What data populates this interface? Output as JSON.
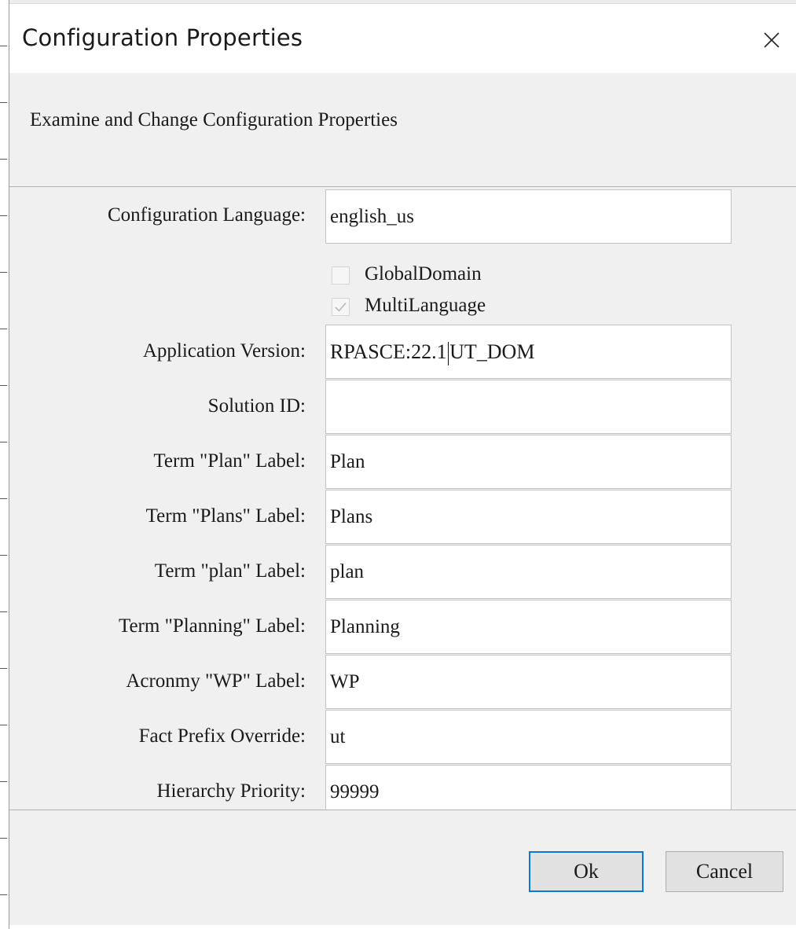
{
  "dialog": {
    "title": "Configuration Properties",
    "close_icon": "close-icon",
    "subtitle": "Examine and Change Configuration Properties"
  },
  "form": {
    "configuration_language": {
      "label": "Configuration Language:",
      "value": "english_us"
    },
    "global_domain": {
      "label": "GlobalDomain",
      "checked": false
    },
    "multi_language": {
      "label": "MultiLanguage",
      "checked": true,
      "disabled": true
    },
    "application_version": {
      "label": "Application Version:",
      "value_before_caret": "RPASCE:22.1",
      "value_after_caret": "UT_DOM"
    },
    "solution_id": {
      "label": "Solution ID:",
      "value": ""
    },
    "term_plan": {
      "label": "Term \"Plan\" Label:",
      "value": "Plan"
    },
    "term_plans": {
      "label": "Term \"Plans\" Label:",
      "value": "Plans"
    },
    "term_plan_lower": {
      "label": "Term \"plan\" Label:",
      "value": "plan"
    },
    "term_planning": {
      "label": "Term \"Planning\" Label:",
      "value": "Planning"
    },
    "acronym_wp": {
      "label": "Acronmy \"WP\" Label:",
      "value": "WP"
    },
    "fact_prefix_override": {
      "label": "Fact Prefix Override:",
      "value": "ut"
    },
    "hierarchy_priority": {
      "label": "Hierarchy Priority:",
      "value": "99999"
    }
  },
  "buttons": {
    "ok_label": "Ok",
    "cancel_label": "Cancel"
  },
  "colors": {
    "dialog_background": "#f0f0f0",
    "default_button_border": "#0a78d7",
    "field_background": "#ffffff"
  }
}
